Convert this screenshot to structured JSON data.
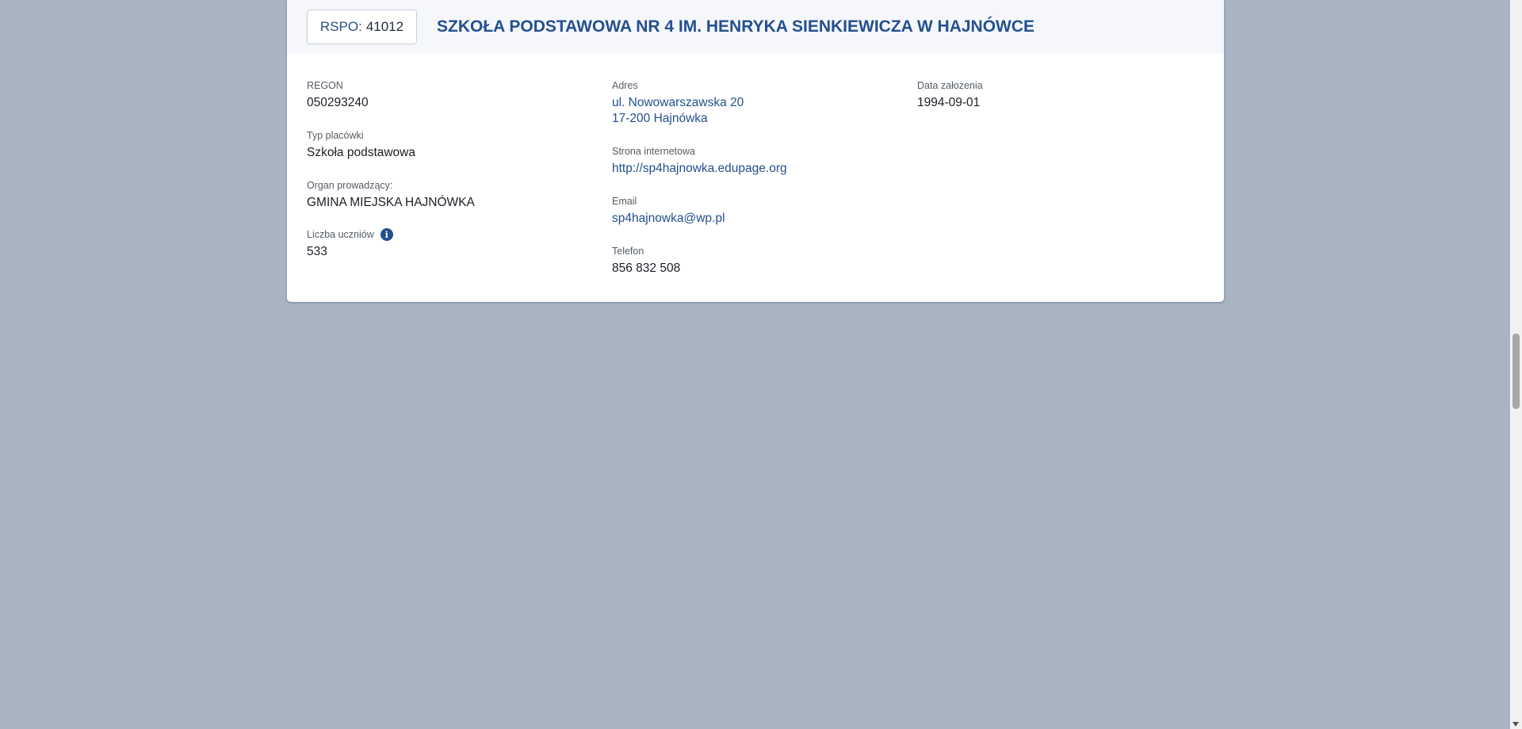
{
  "header": {
    "rspo_label": "RSPO:",
    "rspo_value": "41012",
    "school_name": "SZKOŁA PODSTAWOWA NR 4 IM. HENRYKA SIENKIEWICZA W HAJNÓWCE"
  },
  "col1": {
    "regon": {
      "label": "REGON",
      "value": "050293240"
    },
    "type": {
      "label": "Typ placówki",
      "value": "Szkoła podstawowa"
    },
    "organ": {
      "label": "Organ prowadzący:",
      "value": "GMINA MIEJSKA HAJNÓWKA"
    },
    "students": {
      "label": "Liczba uczniów",
      "value": "533",
      "icon": "info-icon"
    }
  },
  "col2": {
    "address": {
      "label": "Adres",
      "line1": "ul. Nowowarszawska 20",
      "line2": "17-200 Hajnówka"
    },
    "website": {
      "label": "Strona internetowa",
      "value": "http://sp4hajnowka.edupage.org"
    },
    "email": {
      "label": "Email",
      "value": "sp4hajnowka@wp.pl"
    },
    "phone": {
      "label": "Telefon",
      "value": "856 832 508"
    }
  },
  "col3": {
    "founded": {
      "label": "Data założenia",
      "value": "1994-09-01"
    }
  },
  "colors": {
    "background": "#a9b4c3",
    "accent": "#24508e",
    "header_bg": "#f5f7fb"
  }
}
